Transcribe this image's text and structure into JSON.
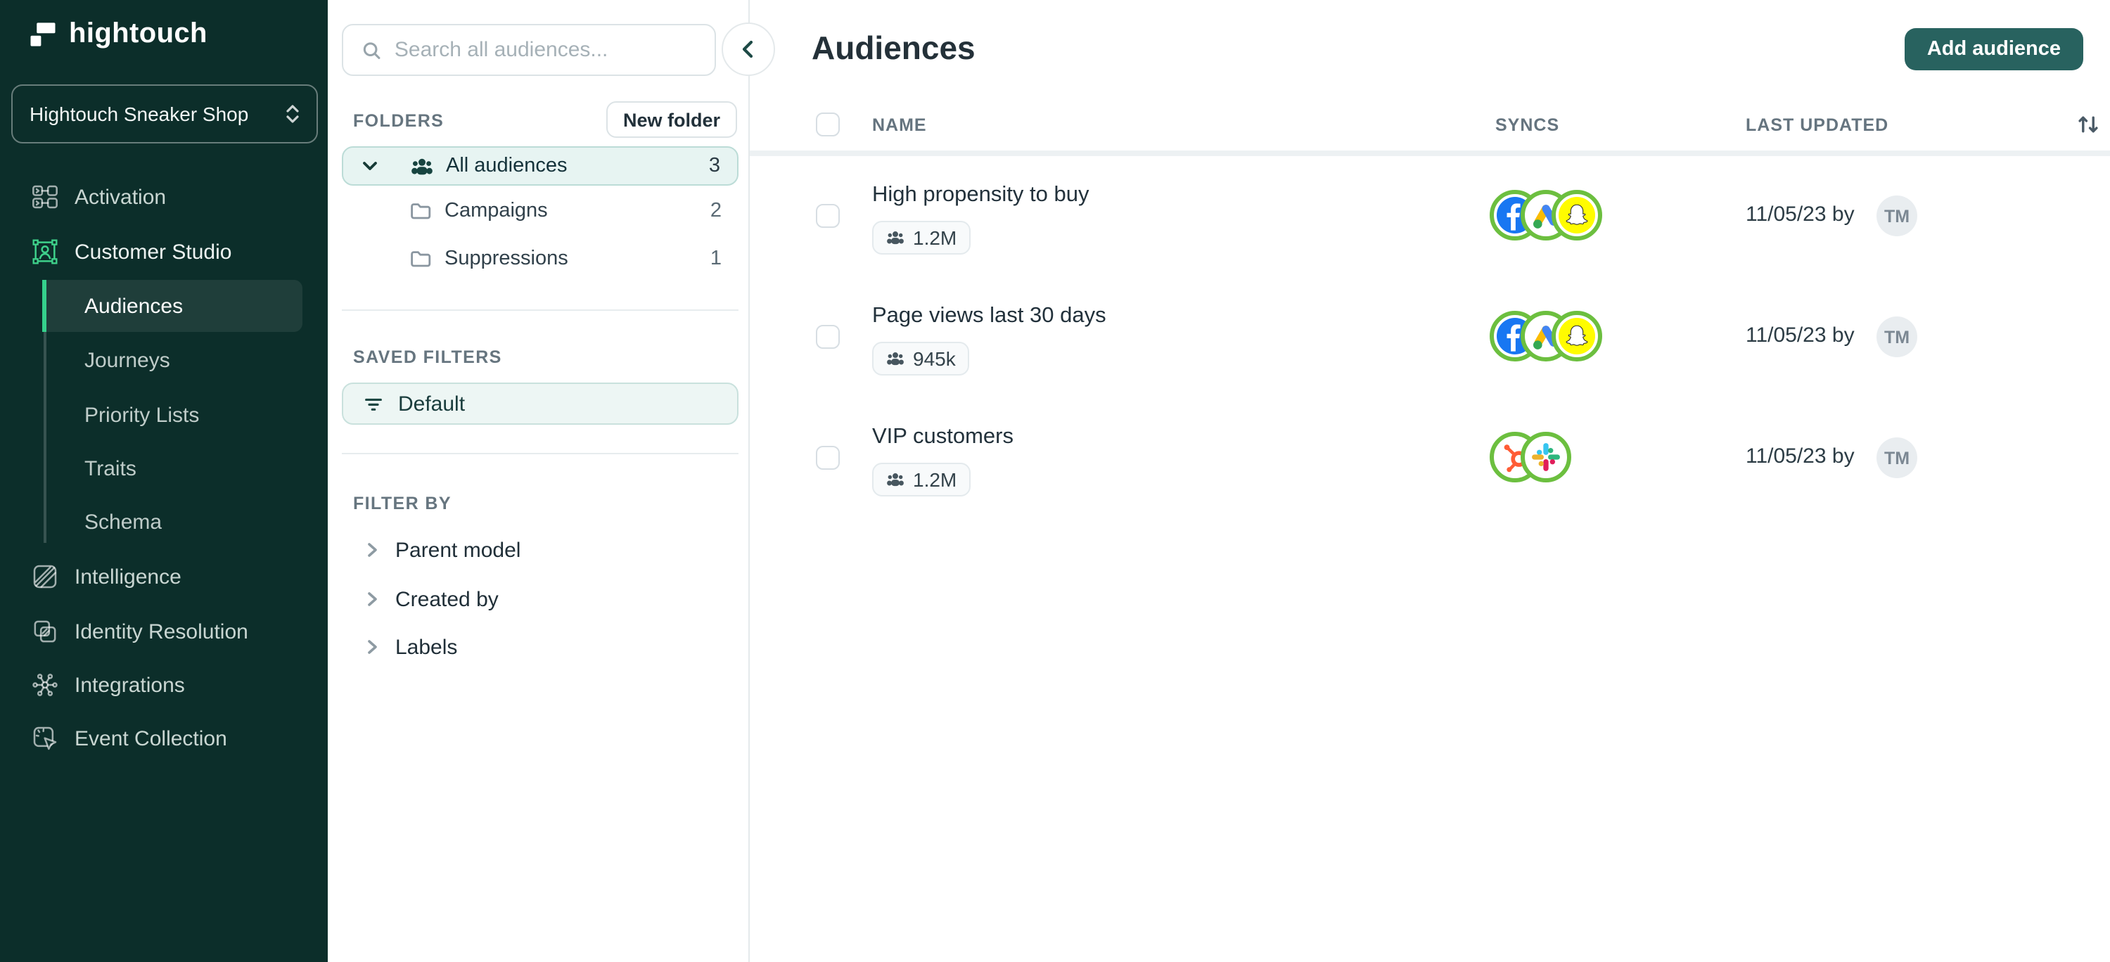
{
  "app": {
    "name": "hightouch",
    "workspace": "Hightouch Sneaker Shop"
  },
  "colors": {
    "sidebar_bg": "#0c2e2a",
    "accent_green": "#35d18c",
    "primary_teal": "#28625f",
    "selected_tint": "#e7f4f2",
    "sync_ring_green": "#6cbf3f"
  },
  "sidebar": {
    "items_top": [
      {
        "label": "Activation",
        "icon": "workflow-icon"
      },
      {
        "label": "Customer Studio",
        "icon": "customer-studio-icon"
      }
    ],
    "customer_studio_children": [
      {
        "label": "Audiences",
        "selected": true
      },
      {
        "label": "Journeys"
      },
      {
        "label": "Priority Lists"
      },
      {
        "label": "Traits"
      },
      {
        "label": "Schema"
      }
    ],
    "items_bottom": [
      {
        "label": "Intelligence",
        "icon": "intelligence-icon"
      },
      {
        "label": "Identity Resolution",
        "icon": "identity-resolution-icon"
      },
      {
        "label": "Integrations",
        "icon": "integrations-icon"
      },
      {
        "label": "Event Collection",
        "icon": "event-collection-icon"
      }
    ]
  },
  "browse_panel": {
    "search_placeholder": "Search all audiences...",
    "folders": {
      "heading": "FOLDERS",
      "new_folder_button": "New folder",
      "rows": [
        {
          "name": "All audiences",
          "count": "3",
          "selected": true,
          "icon": "people-icon"
        },
        {
          "name": "Campaigns",
          "count": "2",
          "icon": "folder-icon"
        },
        {
          "name": "Suppressions",
          "count": "1",
          "icon": "folder-icon"
        }
      ]
    },
    "saved_filters": {
      "heading": "SAVED FILTERS",
      "items": [
        {
          "name": "Default",
          "selected": true,
          "icon": "filter-icon"
        }
      ]
    },
    "filter_by": {
      "heading": "FILTER BY",
      "items": [
        {
          "name": "Parent model"
        },
        {
          "name": "Created by"
        },
        {
          "name": "Labels"
        }
      ]
    }
  },
  "main": {
    "title": "Audiences",
    "add_button": "Add audience",
    "table": {
      "columns": [
        "NAME",
        "SYNCS",
        "LAST UPDATED"
      ],
      "rows": [
        {
          "name": "High propensity to buy",
          "size": "1.2M",
          "syncs": [
            "facebook",
            "google-ads",
            "snapchat"
          ],
          "last_updated": "11/05/23 by",
          "avatar": "TM"
        },
        {
          "name": "Page views last 30 days",
          "size": "945k",
          "syncs": [
            "facebook",
            "google-ads",
            "snapchat"
          ],
          "last_updated": "11/05/23 by",
          "avatar": "TM"
        },
        {
          "name": "VIP customers",
          "size": "1.2M",
          "syncs": [
            "hubspot",
            "slack"
          ],
          "last_updated": "11/05/23 by",
          "avatar": "TM"
        }
      ]
    }
  }
}
